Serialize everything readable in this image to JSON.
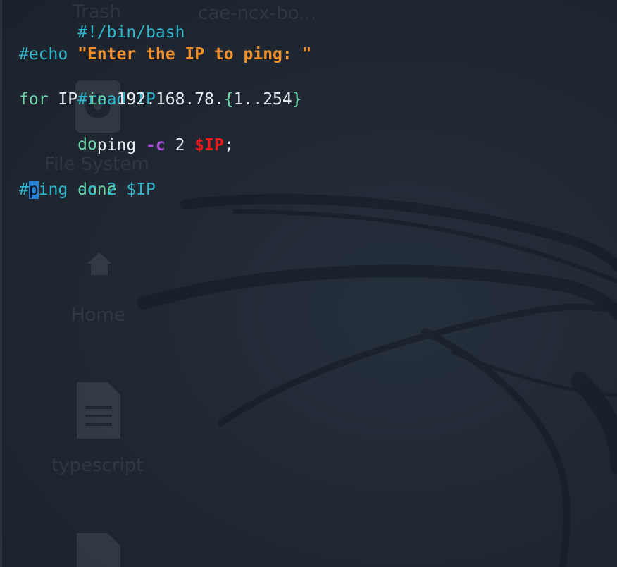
{
  "desktop": {
    "icons": [
      {
        "label": "Trash",
        "icon": "trash-icon"
      },
      {
        "label": "File System",
        "icon": "drive-icon"
      },
      {
        "label": "Home",
        "icon": "home-icon"
      },
      {
        "label": "typescript",
        "icon": "document-icon"
      }
    ],
    "folder_label": "cae-ncx-bo..."
  },
  "editor": {
    "lines": [
      {
        "text": "#!/bin/bash"
      },
      {
        "text": ""
      },
      {
        "parts": [
          "#echo ",
          "\"Enter the IP to ping: \""
        ]
      },
      {
        "text": "#read IP"
      },
      {
        "parts": [
          "for",
          " IP ",
          "in",
          " 192.168.78.",
          "{",
          "1..254",
          "}"
        ]
      },
      {
        "text": "do"
      },
      {
        "parts": [
          "        ping ",
          "-c",
          " 2 ",
          "$IP",
          ";"
        ]
      },
      {
        "text": "done"
      },
      {
        "parts": [
          "#",
          "p",
          "ing -c 2 $IP"
        ]
      }
    ]
  },
  "colors": {
    "background": "#1f2631",
    "comment": "#2eb6c9",
    "keyword": "#6fd3a8",
    "string": "#f4902a",
    "option": "#a74fd3",
    "variable": "#f0161a",
    "cursor": "#2a83d4"
  }
}
